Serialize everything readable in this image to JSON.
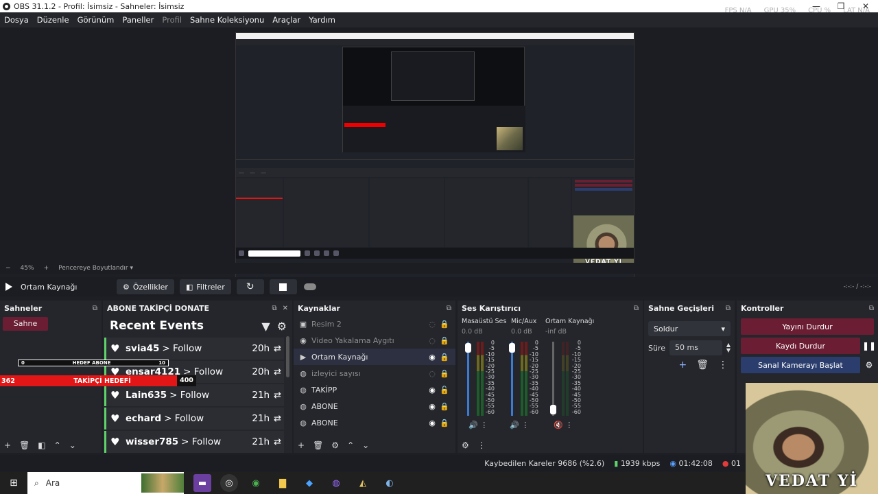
{
  "window": {
    "title": "OBS 31.1.2 - Profil: İsimsiz - Sahneler: İsimsiz",
    "controls": [
      "—",
      "❐",
      "✕"
    ],
    "stats": [
      "FPS N/A",
      "GPU 35%",
      "CPU %",
      "LAT N/A"
    ]
  },
  "menu": {
    "items": [
      "Dosya",
      "Düzenle",
      "Görünüm",
      "Paneller",
      "Profil",
      "Sahne Koleksiyonu",
      "Araçlar",
      "Yardım"
    ]
  },
  "preview": {
    "facecam_label": "VEDAT Yİ"
  },
  "zoom": {
    "minus": "−",
    "value": "45%",
    "plus": "+",
    "fit_label": "Pencereye Boyutlandır"
  },
  "controlbar": {
    "source_label": "Ortam Kaynağı",
    "properties": "Özellikler",
    "filters": "Filtreler",
    "timecode": "-:-:-  /  -:-:-"
  },
  "scenes": {
    "title": "Sahneler",
    "items": [
      "Sahne"
    ]
  },
  "goal_bar": {
    "left": "0",
    "label": "HEDEF ABONE",
    "right": "10"
  },
  "follower_goal": {
    "current": "362",
    "label": "TAKİPÇİ HEDEFİ",
    "target": "400"
  },
  "events": {
    "dock_title": "ABONE TAKİPÇİ DONATE",
    "title": "Recent Events",
    "rows": [
      {
        "user": "svia45",
        "action": "> Follow",
        "time": "20h"
      },
      {
        "user": "ensar4121",
        "action": "> Follow",
        "time": "20h"
      },
      {
        "user": "Lain635",
        "action": "> Follow",
        "time": "21h"
      },
      {
        "user": "echard",
        "action": "> Follow",
        "time": "21h"
      },
      {
        "user": "wisser785",
        "action": "> Follow",
        "time": "21h"
      }
    ]
  },
  "sources": {
    "title": "Kaynaklar",
    "items": [
      {
        "name": "Resim 2",
        "visible": false
      },
      {
        "name": "Video Yakalama Aygıtı",
        "visible": false
      },
      {
        "name": "Ortam Kaynağı",
        "visible": true
      },
      {
        "name": "izleyici sayısı",
        "visible": false
      },
      {
        "name": "TAKİPP",
        "visible": true
      },
      {
        "name": "ABONE",
        "visible": true
      },
      {
        "name": "ABONE",
        "visible": true
      }
    ]
  },
  "mixer": {
    "title": "Ses Karıştırıcı",
    "channels": [
      {
        "name": "Masaüstü Ses",
        "db": "0.0 dB"
      },
      {
        "name": "Mic/Aux",
        "db": "0.0 dB"
      },
      {
        "name": "Ortam Kaynağı",
        "db": "-inf dB"
      }
    ],
    "scale": [
      "0",
      "-5",
      "-10",
      "-15",
      "-20",
      "-25",
      "-30",
      "-35",
      "-40",
      "-45",
      "-50",
      "-55",
      "-60"
    ]
  },
  "transitions": {
    "title": "Sahne Geçişleri",
    "selected": "Soldur",
    "duration_label": "Süre",
    "duration_value": "50 ms"
  },
  "controls": {
    "title": "Kontroller",
    "stop_stream": "Yayını Durdur",
    "stop_record": "Kaydı Durdur",
    "virtual_cam": "Sanal Kamerayı Başlat"
  },
  "facecam": {
    "label": "VEDAT Yİ"
  },
  "status": {
    "dropped": "Kaybedilen Kareler 9686 (%2.6)",
    "bitrate": "1939 kbps",
    "stream_time": "01:42:08",
    "rec_time": "01"
  },
  "taskbar": {
    "search_placeholder": "Ara"
  },
  "colors": {
    "accent_red": "#6b1d33",
    "accent_blue": "#2a3d6c",
    "goal_red": "#e21616",
    "follow_green": "#5fd36b"
  }
}
